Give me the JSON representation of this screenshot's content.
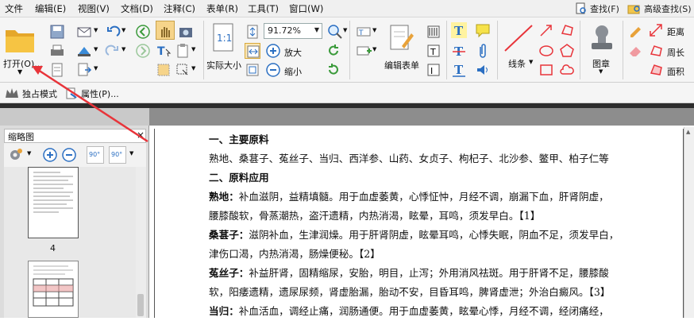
{
  "menu": [
    "文件",
    "编辑(E)",
    "视图(V)",
    "文档(D)",
    "注释(C)",
    "表单(R)",
    "工具(T)",
    "窗口(W)"
  ],
  "right_buttons": {
    "find": "查找(F)",
    "advanced_find": "高级查找(S)"
  },
  "ribbon": {
    "open": "打开(O)...",
    "actual_size": "实际大小",
    "zoom_value": "91.72%",
    "zoom_in": "放大",
    "zoom_out": "缩小",
    "edit_form": "编辑表单",
    "lines": "线条",
    "stamp": "图章",
    "distance": "距离",
    "perimeter": "周长",
    "area": "面积"
  },
  "toolbar2": {
    "exclusive_mode": "独占模式",
    "properties": "属性(P)..."
  },
  "panel": {
    "title": "缩略图",
    "page_label": "4",
    "zoom_badge_a": "90°",
    "zoom_badge_b": "90°"
  },
  "document": {
    "lines": [
      {
        "bold": "一、主要原料",
        "text": ""
      },
      {
        "bold": "",
        "text": "熟地、桑葚子、菟丝子、当归、西洋参、山药、女贞子、枸杞子、北沙参、鳖甲、柏子仁等"
      },
      {
        "bold": "二、原料应用",
        "text": ""
      },
      {
        "bold": "熟地：",
        "text": "补血滋阴，益精填髓。用于血虚萎黄，心悸怔忡，月经不调，崩漏下血，肝肾阴虚，"
      },
      {
        "bold": "",
        "text": "腰膝酸软，骨蒸潮热，盗汗遗精，内热消渴，眩晕，耳鸣，须发早白。【1】"
      },
      {
        "bold": "桑葚子：",
        "text": "滋阴补血，生津润燥。用于肝肾阴虚，眩晕耳鸣，心悸失眠，阴血不足，须发早白，"
      },
      {
        "bold": "",
        "text": "津伤口渴，内热消渴，肠燥便秘。【2】"
      },
      {
        "bold": "菟丝子：",
        "text": "补益肝肾，固精缩尿，安胎，明目，止泻；外用消风祛斑。用于肝肾不足，腰膝酸"
      },
      {
        "bold": "",
        "text": "软，阳痿遗精，遗尿尿频，肾虚胎漏，胎动不安，目昏耳鸣，脾肾虚泄；外治白癜风。【3】"
      },
      {
        "bold": "当归：",
        "text": "补血活血，调经止痛，润肠通便。用于血虚萎黄，眩晕心悸，月经不调，经闭痛经，"
      }
    ]
  },
  "colors": {
    "arrow": "#e8343a",
    "accent_blue": "#2b6fc2",
    "ribbon_bg": "#f5f5f5",
    "tabstrip": "#2d2d2d"
  }
}
